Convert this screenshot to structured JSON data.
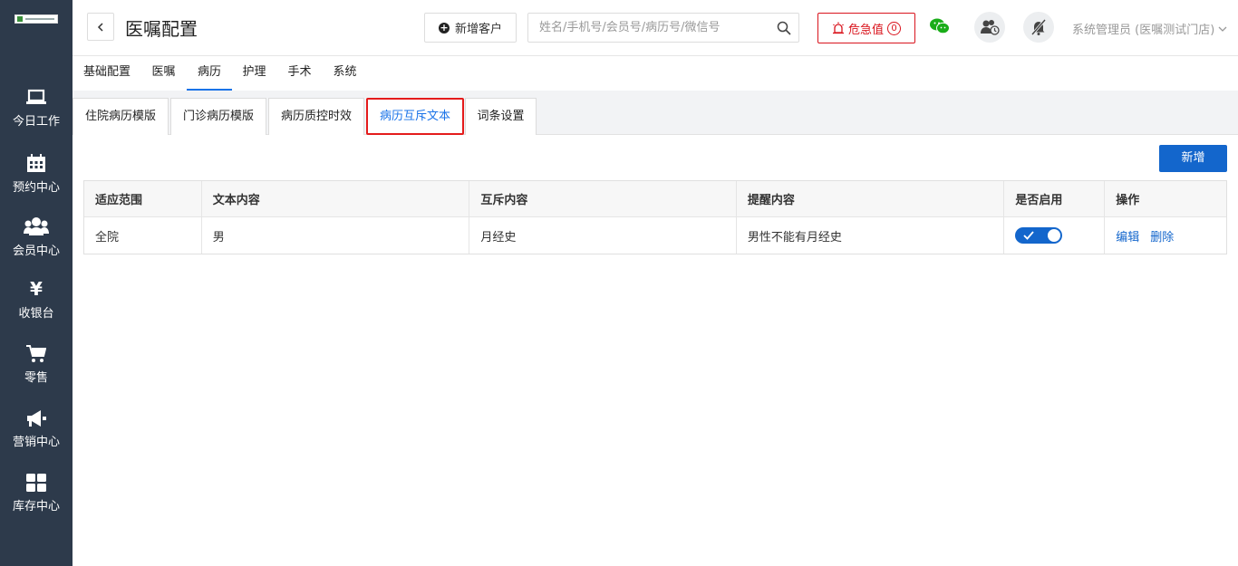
{
  "sidebar": {
    "logo": "logo",
    "items": [
      {
        "label": "今日工作",
        "icon": "laptop-icon"
      },
      {
        "label": "预约中心",
        "icon": "calendar-icon"
      },
      {
        "label": "会员中心",
        "icon": "members-icon"
      },
      {
        "label": "收银台",
        "icon": "yen-icon"
      },
      {
        "label": "零售",
        "icon": "cart-icon"
      },
      {
        "label": "营销中心",
        "icon": "megaphone-icon"
      },
      {
        "label": "库存中心",
        "icon": "grid-icon"
      }
    ],
    "yen_glyph": "¥"
  },
  "header": {
    "title": "医嘱配置",
    "add_customer": "新增客户",
    "search_placeholder": "姓名/手机号/会员号/病历号/微信号",
    "danger_label": "危急值",
    "danger_count": "0",
    "user": "系统管理员 (医嘱测试门店)"
  },
  "tabs": [
    "基础配置",
    "医嘱",
    "病历",
    "护理",
    "手术",
    "系统"
  ],
  "active_tab": "病历",
  "subtabs": [
    "住院病历模版",
    "门诊病历模版",
    "病历质控时效",
    "病历互斥文本",
    "词条设置"
  ],
  "active_subtab": "病历互斥文本",
  "actions": {
    "new_label": "新增"
  },
  "table": {
    "columns": [
      "适应范围",
      "文本内容",
      "互斥内容",
      "提醒内容",
      "是否启用",
      "操作"
    ],
    "rows": [
      {
        "scope": "全院",
        "text": "男",
        "exclusive": "月经史",
        "reminder": "男性不能有月经史",
        "enabled": true,
        "edit": "编辑",
        "delete": "删除"
      }
    ]
  },
  "colors": {
    "sidebar": "#2d3a4b",
    "primary": "#1366cc",
    "danger": "#d9141d",
    "highlight": "#e41b1b"
  }
}
